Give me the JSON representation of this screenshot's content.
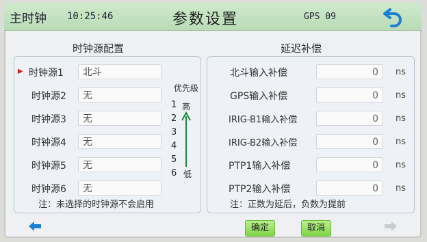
{
  "header": {
    "mode": "主时钟",
    "time": "10:25:46",
    "title": "参数设置",
    "gps": "GPS 09"
  },
  "clock_sources": {
    "title": "时钟源配置",
    "rows": [
      {
        "label": "时钟源1",
        "value": "北斗",
        "selected": true
      },
      {
        "label": "时钟源2",
        "value": "无"
      },
      {
        "label": "时钟源3",
        "value": "无"
      },
      {
        "label": "时钟源4",
        "value": "无"
      },
      {
        "label": "时钟源5",
        "value": "无"
      },
      {
        "label": "时钟源6",
        "value": "无"
      }
    ],
    "priority": {
      "title": "优先级",
      "numbers": [
        "1",
        "2",
        "3",
        "4",
        "5",
        "6"
      ],
      "high": "高",
      "low": "低"
    },
    "note": "注：未选择的时钟源不会启用"
  },
  "delay_comp": {
    "title": "延迟补偿",
    "rows": [
      {
        "label": "北斗输入补偿",
        "value": "0",
        "unit": "ns"
      },
      {
        "label": "GPS输入补偿",
        "value": "0",
        "unit": "ns"
      },
      {
        "label": "IRIG-B1输入补偿",
        "value": "0",
        "unit": "ns"
      },
      {
        "label": "IRIG-B2输入补偿",
        "value": "0",
        "unit": "ns"
      },
      {
        "label": "PTP1输入补偿",
        "value": "0",
        "unit": "ns"
      },
      {
        "label": "PTP2输入补偿",
        "value": "0",
        "unit": "ns"
      }
    ],
    "note": "注：正数为延后，负数为提前"
  },
  "buttons": {
    "confirm": "确定",
    "cancel": "取消"
  },
  "colors": {
    "header": "#bfe0bc",
    "accent_blue": "#1a7fd6",
    "button_green": "#8fdc57",
    "priority_arrow": "#1a8a3a",
    "selected_marker": "#dd2222"
  }
}
